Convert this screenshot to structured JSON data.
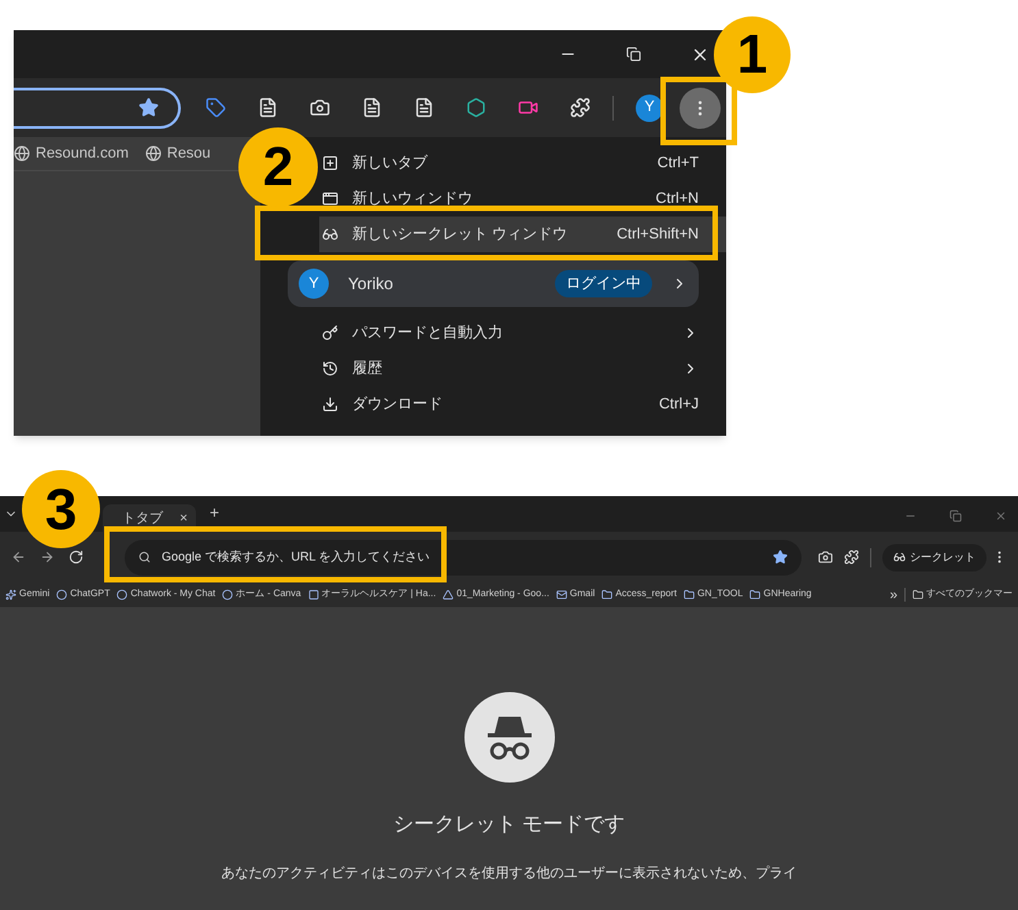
{
  "step1": {
    "badge": "1",
    "bookmarks": [
      {
        "label": "Resound.com"
      },
      {
        "label": "Resou"
      }
    ],
    "menu": [
      {
        "kind": "item",
        "label": "新しいタブ",
        "shortcut": "Ctrl+T",
        "selected": false
      },
      {
        "kind": "item",
        "label": "新しいウィンドウ",
        "shortcut": "Ctrl+N",
        "selected": false
      },
      {
        "kind": "item",
        "label": "新しいシークレット ウィンドウ",
        "shortcut": "Ctrl+Shift+N",
        "selected": true
      },
      {
        "kind": "profile",
        "avatar": "Y",
        "label": "Yoriko",
        "status": "ログイン中"
      },
      {
        "kind": "submenu",
        "label": "パスワードと自動入力"
      },
      {
        "kind": "submenu",
        "label": "履歴"
      },
      {
        "kind": "item",
        "label": "ダウンロード",
        "shortcut": "Ctrl+J",
        "selected": false
      }
    ],
    "avatar": "Y"
  },
  "step2": {
    "badge": "2"
  },
  "step3": {
    "badge": "3",
    "tab": {
      "title": "トタブ",
      "close": "×"
    },
    "new_tab": "+",
    "address": {
      "placeholder": "Google で検索するか、URL を入力してください"
    },
    "incognito_chip": "シークレット",
    "bookmarks": [
      {
        "label": "Gemini"
      },
      {
        "label": "ChatGPT"
      },
      {
        "label": "Chatwork - My Chat"
      },
      {
        "label": "ホーム - Canva"
      },
      {
        "label": "オーラルヘルスケア | Ha..."
      },
      {
        "label": "01_Marketing - Goo..."
      },
      {
        "label": "Gmail"
      },
      {
        "label": "Access_report"
      },
      {
        "label": "GN_TOOL"
      },
      {
        "label": "GNHearing"
      }
    ],
    "more": "»",
    "all_bookmarks": "すべてのブックマー",
    "heading": "シークレット モードです",
    "body": "あなたのアクティビティはこのデバイスを使用する他のユーザーに表示されないため、プライ"
  }
}
